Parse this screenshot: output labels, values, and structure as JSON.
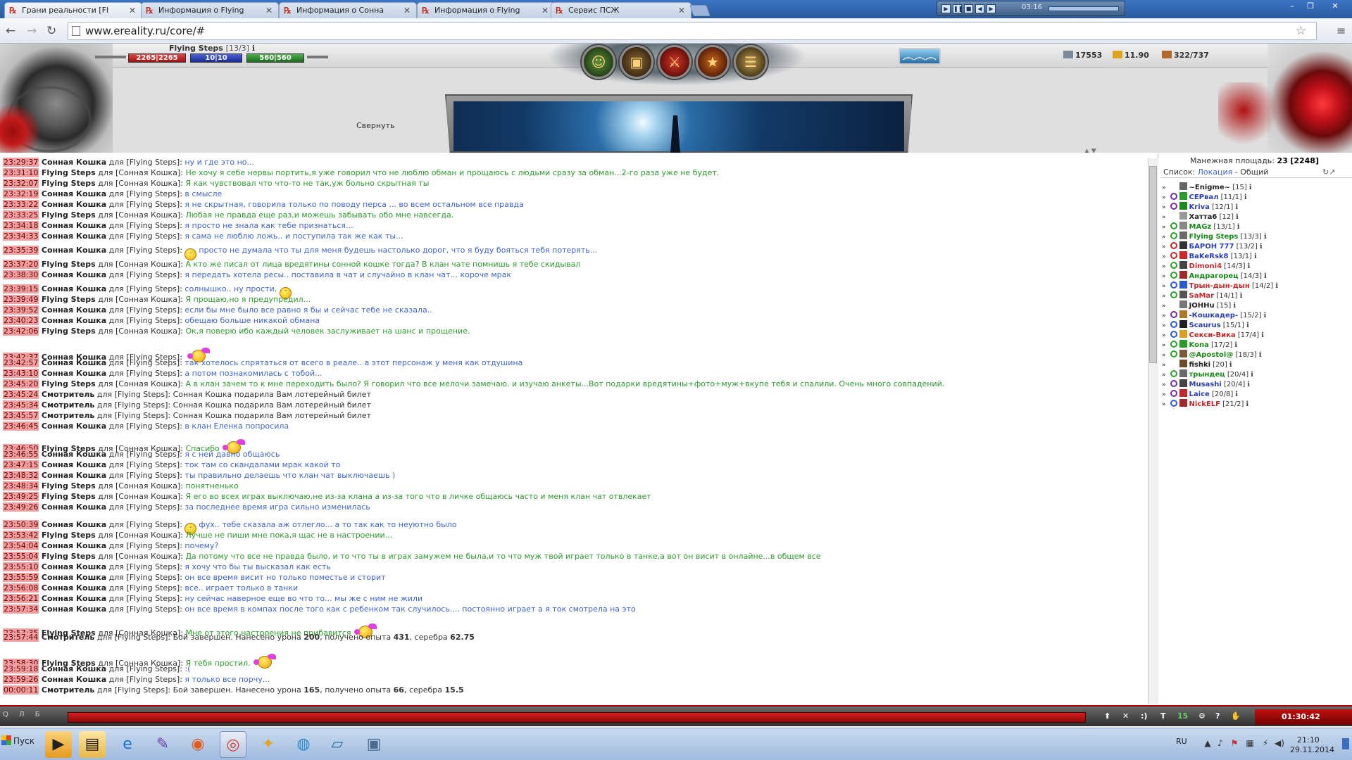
{
  "browser": {
    "tabs": [
      {
        "title": "Грани реальности [Flying",
        "active": true
      },
      {
        "title": "Информация о Flying Ste",
        "active": false
      },
      {
        "title": "Информация о Сонная К",
        "active": false
      },
      {
        "title": "Информация о Flying Ste",
        "active": false
      },
      {
        "title": "Сервис ПСЖ",
        "active": false
      }
    ],
    "media_time": "03:16",
    "url": "www.ereality.ru/core/#"
  },
  "game_header": {
    "char_name": "Flying Steps",
    "char_level": "[13/3]",
    "hp": "2265|2265",
    "mp": "10|10",
    "energy": "560|560",
    "resources": {
      "r1": "17553",
      "r2": "11.90",
      "r3": "322/737"
    },
    "collapse_label": "Свернуть"
  },
  "chat": {
    "lines": [
      {
        "t": "23:29:37",
        "s": "Сонная Кошка",
        "to": "Flying Steps",
        "m": "ну и где это но...",
        "c": "b"
      },
      {
        "t": "23:31:10",
        "s": "Flying Steps",
        "to": "Сонная Кошка",
        "m": "Не хочу я себе нервы портить,я уже говорил что не люблю обман и прощаюсь с людьми сразу за обман...2-го раза уже не будет.",
        "c": "g"
      },
      {
        "t": "23:32:07",
        "s": "Flying Steps",
        "to": "Сонная Кошка",
        "m": "Я как чувствовал что что-то не так,уж больно скрытная ты",
        "c": "g"
      },
      {
        "t": "23:32:19",
        "s": "Сонная Кошка",
        "to": "Flying Steps",
        "m": "в смысле",
        "c": "b"
      },
      {
        "t": "23:33:22",
        "s": "Сонная Кошка",
        "to": "Flying Steps",
        "m": "я не скрытная, говорила только по поводу перса ... во всем остальном все правда",
        "c": "b"
      },
      {
        "t": "23:33:25",
        "s": "Flying Steps",
        "to": "Сонная Кошка",
        "m": "Любая не правда еще раз,и можешь забывать обо мне навсегда.",
        "c": "g"
      },
      {
        "t": "23:34:18",
        "s": "Сонная Кошка",
        "to": "Flying Steps",
        "m": "я просто не знала как тебе признаться...",
        "c": "b"
      },
      {
        "t": "23:34:33",
        "s": "Сонная Кошка",
        "to": "Flying Steps",
        "m": "я сама не люблю ложь.. и поступила так же как ты...",
        "c": "b"
      },
      {
        "t": "23:35:39",
        "s": "Сонная Кошка",
        "to": "Flying Steps",
        "m": "просто не думала что ты для меня будешь настолько дорог, что я буду бояться тебя потерять...",
        "c": "b",
        "pre": "smile"
      },
      {
        "t": "23:37:20",
        "s": "Flying Steps",
        "to": "Сонная Кошка",
        "m": "А кто же писал от лица вредятины сонной кошке тогда? В клан чате помнишь я тебе скидывал",
        "c": "g"
      },
      {
        "t": "23:38:30",
        "s": "Сонная Кошка",
        "to": "Flying Steps",
        "m": "я передать хотела ресы.. поставила в чат и случайно в клан чат... короче мрак",
        "c": "b"
      },
      {
        "t": "23:39:15",
        "s": "Сонная Кошка",
        "to": "Flying Steps",
        "m": "солнышко.. ну прости,",
        "c": "b",
        "post": "smile"
      },
      {
        "t": "23:39:49",
        "s": "Flying Steps",
        "to": "Сонная Кошка",
        "m": "Я прощаю,но я предупредил...",
        "c": "g"
      },
      {
        "t": "23:39:52",
        "s": "Сонная Кошка",
        "to": "Flying Steps",
        "m": "если бы мне было все равно я бы и сейчас тебе не сказала..",
        "c": "b"
      },
      {
        "t": "23:40:23",
        "s": "Сонная Кошка",
        "to": "Flying Steps",
        "m": "обещаю больше никакой обмана",
        "c": "b"
      },
      {
        "t": "23:42:06",
        "s": "Flying Steps",
        "to": "Сонная Кошка",
        "m": "Ок,я поверю ибо каждый человек заслуживает на шанс и прощение.",
        "c": "g"
      },
      {
        "t": "23:42:37",
        "s": "Сонная Кошка",
        "to": "Flying Steps",
        "m": "",
        "c": "b",
        "post": "fly"
      },
      {
        "t": "23:42:57",
        "s": "Сонная Кошка",
        "to": "Flying Steps",
        "m": "так хотелось спрятаться от всего в реале.. а этот персонаж у меня как отдушина",
        "c": "b"
      },
      {
        "t": "23:43:10",
        "s": "Сонная Кошка",
        "to": "Flying Steps",
        "m": "а потом познакомилась с тобой...",
        "c": "b"
      },
      {
        "t": "23:45:20",
        "s": "Flying Steps",
        "to": "Сонная Кошка",
        "m": "А в клан зачем то к мне переходить было? Я говорил что все мелочи замечаю. и изучаю анкеты...Вот подарки вредятины+фото+муж+вкупе тебя и спалили. Очень много совпадений.",
        "c": "g"
      },
      {
        "t": "23:45:24",
        "s": "Смотритель",
        "to": "Flying Steps",
        "m": "Сонная Кошка подарила Вам лотерейный билет",
        "c": "k"
      },
      {
        "t": "23:45:34",
        "s": "Смотритель",
        "to": "Flying Steps",
        "m": "Сонная Кошка подарила Вам лотерейный билет",
        "c": "k"
      },
      {
        "t": "23:45:57",
        "s": "Смотритель",
        "to": "Flying Steps",
        "m": "Сонная Кошка подарила Вам лотерейный билет",
        "c": "k"
      },
      {
        "t": "23:46:45",
        "s": "Сонная Кошка",
        "to": "Flying Steps",
        "m": "в клан Еленка попросила",
        "c": "b"
      },
      {
        "t": "23:46:50",
        "s": "Flying Steps",
        "to": "Сонная Кошка",
        "m": "Спасибо",
        "c": "g",
        "post": "fly"
      },
      {
        "t": "23:46:55",
        "s": "Сонная Кошка",
        "to": "Flying Steps",
        "m": "я с ней давно общаюсь",
        "c": "b"
      },
      {
        "t": "23:47:15",
        "s": "Сонная Кошка",
        "to": "Flying Steps",
        "m": "ток там со скандалами мрак какой то",
        "c": "b"
      },
      {
        "t": "23:48:32",
        "s": "Сонная Кошка",
        "to": "Flying Steps",
        "m": "ты правильно делаешь что клан чат выключаешь )",
        "c": "b"
      },
      {
        "t": "23:48:34",
        "s": "Flying Steps",
        "to": "Сонная Кошка",
        "m": "понятненько",
        "c": "g"
      },
      {
        "t": "23:49:25",
        "s": "Flying Steps",
        "to": "Сонная Кошка",
        "m": "Я его во всех играх выключаю,не из-за клана а из-за того что в личке общаюсь часто и меня клан чат отвлекает",
        "c": "g"
      },
      {
        "t": "23:49:26",
        "s": "Сонная Кошка",
        "to": "Flying Steps",
        "m": "за последнее время игра сильно изменилась",
        "c": "b"
      },
      {
        "t": "23:50:39",
        "s": "Сонная Кошка",
        "to": "Flying Steps",
        "m": "фух.. тебе сказала аж отлегло... а то так как то неуютно было",
        "c": "b",
        "pre": "smile"
      },
      {
        "t": "23:53:42",
        "s": "Flying Steps",
        "to": "Сонная Кошка",
        "m": "Лучше не пиши мне пока,я щас не в настроении...",
        "c": "g"
      },
      {
        "t": "23:54:04",
        "s": "Сонная Кошка",
        "to": "Flying Steps",
        "m": "почему?",
        "c": "b"
      },
      {
        "t": "23:55:04",
        "s": "Flying Steps",
        "to": "Сонная Кошка",
        "m": "Да потому что все не правда было, и то что ты в играх замужем не была,и то что муж твой играет только в танке,а вот он висит в онлайне...в общем все",
        "c": "g"
      },
      {
        "t": "23:55:10",
        "s": "Сонная Кошка",
        "to": "Flying Steps",
        "m": "я хочу что бы ты высказал как есть",
        "c": "b"
      },
      {
        "t": "23:55:59",
        "s": "Сонная Кошка",
        "to": "Flying Steps",
        "m": "он все время висит но только поместье и сторит",
        "c": "b"
      },
      {
        "t": "23:56:08",
        "s": "Сонная Кошка",
        "to": "Flying Steps",
        "m": "все.. играет только в танки",
        "c": "b"
      },
      {
        "t": "23:56:21",
        "s": "Сонная Кошка",
        "to": "Flying Steps",
        "m": "ну сейчас наверное еще во что то... мы же с ним не жили",
        "c": "b"
      },
      {
        "t": "23:57:34",
        "s": "Сонная Кошка",
        "to": "Flying Steps",
        "m": "он все время в компах после того как с ребенком так случилось.... постоянно играет а я ток смотрела на это",
        "c": "b"
      },
      {
        "t": "23:57:35",
        "s": "Flying Steps",
        "to": "Сонная Кошка",
        "m": "Мне от этого настроения не прибавится",
        "c": "g",
        "post": "fly"
      },
      {
        "t": "23:57:44",
        "s": "Смотритель",
        "to": "Flying Steps",
        "m": "Бой завершен.",
        "c": "k",
        "battle": {
          "dmg": "200",
          "exp": "431",
          "silver": "62.75"
        }
      },
      {
        "t": "23:58:30",
        "s": "Flying Steps",
        "to": "Сонная Кошка",
        "m": "Я тебя простил.",
        "c": "g",
        "post": "fly"
      },
      {
        "t": "23:59:18",
        "s": "Сонная Кошка",
        "to": "Flying Steps",
        "m": ":(",
        "c": "b"
      },
      {
        "t": "23:59:26",
        "s": "Сонная Кошка",
        "to": "Flying Steps",
        "m": "я только все порчу...",
        "c": "b"
      },
      {
        "t": "00:00:11",
        "s": "Смотритель",
        "to": "Flying Steps",
        "m": "Бой завершен.",
        "c": "k",
        "battle": {
          "dmg": "165",
          "exp": "66",
          "silver": "15.5"
        }
      }
    ],
    "for_word": "для",
    "battle_words": {
      "dealt": "Нанесено урона",
      "got": "получено опыта",
      "silver": "серебра"
    }
  },
  "users": {
    "header": "Манежная площадь:",
    "count": "23",
    "total": "[2248]",
    "list_label": "Список:",
    "loc_link": "Локация",
    "sep": " - ",
    "common_link": "Общий",
    "rows": [
      {
        "n": "~Enigme~",
        "l": "[15]",
        "c": "#222",
        "k": "none"
      },
      {
        "n": "СЕРвал",
        "l": "[11/1]",
        "c": "#2a3fb0",
        "k": "purple"
      },
      {
        "n": "Kriva",
        "l": "[12/1]",
        "c": "#2a3fb0",
        "k": "purple"
      },
      {
        "n": "Хатта6",
        "l": "[12]",
        "c": "#222",
        "k": "none"
      },
      {
        "n": "MAGz",
        "l": "[13/1]",
        "c": "#1a8a1a",
        "k": "green"
      },
      {
        "n": "Flying Steps",
        "l": "[13/3]",
        "c": "#1a8a1a",
        "k": "green"
      },
      {
        "n": "БАРОН 777",
        "l": "[13/2]",
        "c": "#2a3fb0",
        "k": "red"
      },
      {
        "n": "BaKeRsk8",
        "l": "[13/1]",
        "c": "#2a3fb0",
        "k": "red"
      },
      {
        "n": "Dimoni4",
        "l": "[14/3]",
        "c": "#c0282a",
        "k": "green"
      },
      {
        "n": "Андрагорец",
        "l": "[14/3]",
        "c": "#1a8a1a",
        "k": "green"
      },
      {
        "n": "Трын-дын-дын",
        "l": "[14/2]",
        "c": "#c0282a",
        "k": "blue"
      },
      {
        "n": "SaMar",
        "l": "[14/1]",
        "c": "#c0282a",
        "k": "green"
      },
      {
        "n": "JOHHu",
        "l": "[15]",
        "c": "#222",
        "k": "none"
      },
      {
        "n": "-Кошкадер-",
        "l": "[15/2]",
        "c": "#2a3fb0",
        "k": "purple"
      },
      {
        "n": "Scaurus",
        "l": "[15/1]",
        "c": "#2a3fb0",
        "k": "blue"
      },
      {
        "n": "Секси-Вика",
        "l": "[17/4]",
        "c": "#c0282a",
        "k": "blue"
      },
      {
        "n": "Kona",
        "l": "[17/2]",
        "c": "#1a8a1a",
        "k": "green"
      },
      {
        "n": "@Apostol@",
        "l": "[18/3]",
        "c": "#1a8a1a",
        "k": "green"
      },
      {
        "n": "fishki",
        "l": "[20]",
        "c": "#222",
        "k": "none"
      },
      {
        "n": "трындец",
        "l": "[20/4]",
        "c": "#1a8a1a",
        "k": "green"
      },
      {
        "n": "Musashi",
        "l": "[20/4]",
        "c": "#2a3fb0",
        "k": "purple"
      },
      {
        "n": "Laice",
        "l": "[20/8]",
        "c": "#2a3fb0",
        "k": "purple"
      },
      {
        "n": "NickELF",
        "l": "[21/2]",
        "c": "#c0282a",
        "k": "blue"
      }
    ]
  },
  "bottom_bar": {
    "clock": "01:30:42"
  },
  "taskbar": {
    "start": "Пуск",
    "lang": "RU",
    "time": "21:10",
    "date": "29.11.2014"
  }
}
